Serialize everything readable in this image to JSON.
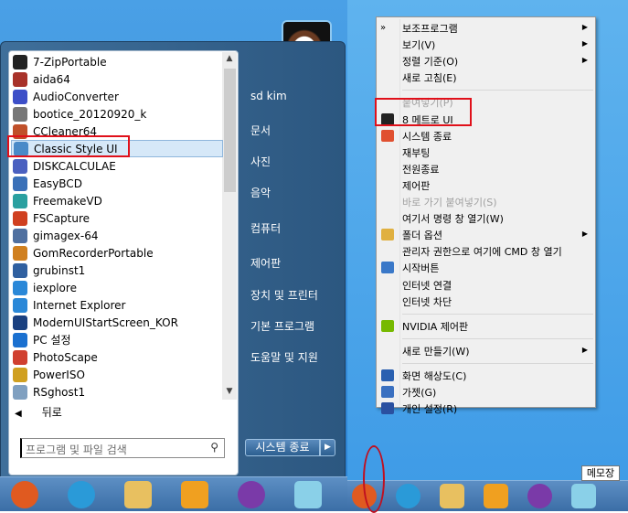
{
  "start_menu": {
    "programs": [
      "7-ZipPortable",
      "aida64",
      "AudioConverter",
      "bootice_20120920_k",
      "CCleaner64",
      "Classic Style UI",
      "DISKCALCULAE",
      "EasyBCD",
      "FreemakeVD",
      "FSCapture",
      "gimagex-64",
      "GomRecorderPortable",
      "grubinst1",
      "iexplore",
      "Internet Explorer",
      "ModernUIStartScreen_KOR",
      "PC 설정",
      "PhotoScape",
      "PowerISO",
      "RSghost1"
    ],
    "program_colors": [
      "#222",
      "#a8322a",
      "#3d4fc8",
      "#777",
      "#c0502a",
      "#4a8ac8",
      "#4a60c0",
      "#3a70b8",
      "#2aa0a0",
      "#d04020",
      "#5070a0",
      "#d08020",
      "#3060a0",
      "#2a88d8",
      "#2a88d8",
      "#1a4080",
      "#1a70d0",
      "#d04030",
      "#d0a020",
      "#80a0c0"
    ],
    "selected_index": 5,
    "back_label": "뒤로",
    "search_placeholder": "프로그램 및 파일 검색",
    "right_items": [
      "sd kim",
      "문서",
      "사진",
      "음악",
      "컴퓨터",
      "제어판",
      "장치 및 프린터",
      "기본 프로그램",
      "도움말 및 지원"
    ],
    "shutdown_label": "시스템 종료"
  },
  "context_menu": {
    "items": [
      {
        "label": "보조프로그램",
        "sub": true
      },
      {
        "label": "보기(V)",
        "sub": true
      },
      {
        "label": "정렬 기준(O)",
        "sub": true
      },
      {
        "label": "새로 고침(E)"
      },
      {
        "sep": true
      },
      {
        "label": "붙여넣기(P)",
        "disabled": true
      },
      {
        "label": "8 메트로 UI",
        "icon": "windows-icon",
        "color": "#222"
      },
      {
        "label": "시스템 종료",
        "icon": "power-icon",
        "color": "#e05030"
      },
      {
        "label": "재부팅"
      },
      {
        "label": "전원종료"
      },
      {
        "label": "제어판"
      },
      {
        "label": "바로 가기 붙여넣기(S)",
        "disabled": true
      },
      {
        "label": "여기서 명령 창 열기(W)"
      },
      {
        "label": "폴더 옵션",
        "sub": true,
        "icon": "folder-options-icon",
        "color": "#e0b040"
      },
      {
        "label": "관리자 권한으로 여기에 CMD 창 열기"
      },
      {
        "label": "시작버튼",
        "icon": "shield-icon",
        "color": "#3a78c8"
      },
      {
        "label": "인터넷 연결"
      },
      {
        "label": "인터넷 차단"
      },
      {
        "sep": true
      },
      {
        "label": "NVIDIA 제어판",
        "icon": "nvidia-icon",
        "color": "#76b900"
      },
      {
        "sep": true
      },
      {
        "label": "새로 만들기(W)",
        "sub": true
      },
      {
        "sep": true
      },
      {
        "label": "화면 해상도(C)",
        "icon": "display-icon",
        "color": "#2a60b0"
      },
      {
        "label": "가젯(G)",
        "icon": "gadget-icon",
        "color": "#3a70c0"
      },
      {
        "label": "개인 설정(R)",
        "icon": "personalize-icon",
        "color": "#2a50a0"
      }
    ],
    "chevron": "»"
  },
  "taskbar_left": [
    "start-orb-icon",
    "internet-explorer-icon",
    "file-explorer-icon",
    "vmware-icon",
    "bittorrent-icon",
    "notepad-icon"
  ],
  "taskbar_right": [
    "start-orb-icon",
    "internet-explorer-icon",
    "file-explorer-icon",
    "vmware-icon",
    "bittorrent-icon",
    "notepad-icon"
  ],
  "taskbar_colors": [
    "#e05a20",
    "#2a9ad8",
    "#e8c060",
    "#f0a020",
    "#7a3aa8",
    "#8ad0e8"
  ],
  "tooltip": "메모장",
  "highlight_color": "#e0101a"
}
